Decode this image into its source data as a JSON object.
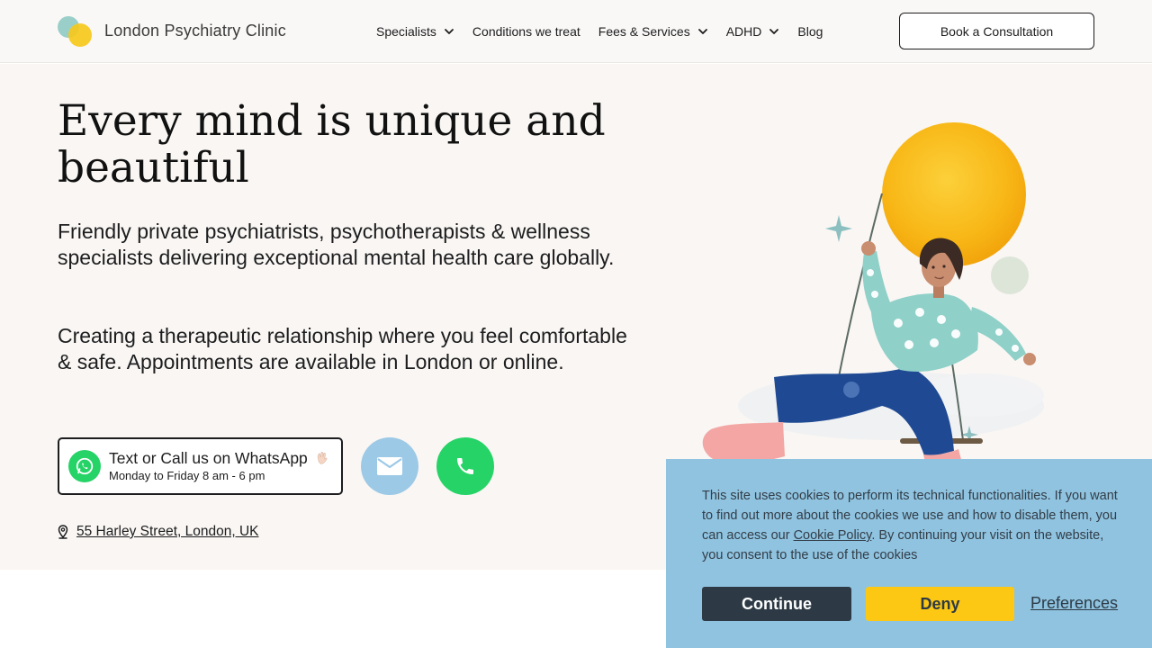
{
  "header": {
    "logo_text": "London Psychiatry Clinic",
    "nav": [
      {
        "label": "Specialists",
        "dropdown": true
      },
      {
        "label": "Conditions we treat",
        "dropdown": false
      },
      {
        "label": "Fees & Services",
        "dropdown": true
      },
      {
        "label": "ADHD",
        "dropdown": true
      },
      {
        "label": "Blog",
        "dropdown": false
      }
    ],
    "cta_label": "Book a Consultation"
  },
  "hero": {
    "title": "Every mind is unique and beautiful",
    "paragraph_1": "Friendly private psychiatrists, psychotherapists & wellness specialists delivering exceptional mental health care globally.",
    "paragraph_2": "Creating a therapeutic relationship where you feel comfortable & safe. Appointments are available in London or online.",
    "whatsapp": {
      "title": "Text or Call us on WhatsApp",
      "hours": "Monday to Friday 8 am - 6 pm",
      "icon": "whatsapp-icon"
    },
    "contact_buttons": [
      {
        "icon": "mail-icon",
        "color": "#9cc9e6"
      },
      {
        "icon": "phone-icon",
        "color": "#25d366"
      }
    ],
    "address": "55 Harley Street, London, UK"
  },
  "cookie_banner": {
    "text_before_link": "This site uses cookies to perform its technical functionalities. If you want to find out more about the cookies we use and how to disable them, you can access our ",
    "link_label": "Cookie Policy",
    "text_after_link": ". By continuing your visit on the website, you consent to the use of the cookies",
    "continue_label": "Continue",
    "deny_label": "Deny",
    "preferences_label": "Preferences"
  },
  "colors": {
    "hero_bg": "#f9f6f3",
    "cookie_bg": "#8fc3e0",
    "continue_bg": "#2d3a45",
    "deny_bg": "#fcc814",
    "whatsapp_green": "#25d366",
    "sun_yellow": "#f8b716",
    "sweater_teal": "#8fd0c8",
    "jeans_blue": "#1f4a93"
  }
}
